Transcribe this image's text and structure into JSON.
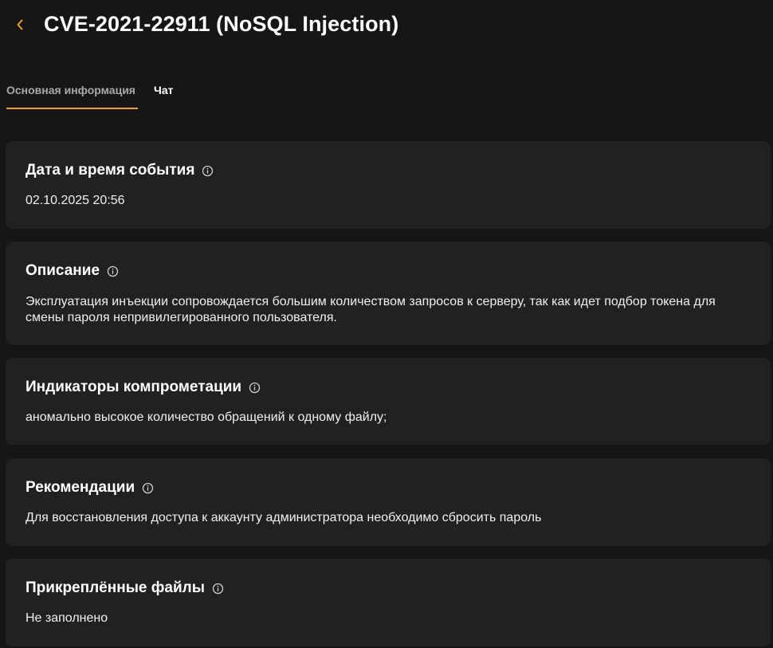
{
  "header": {
    "title": "CVE-2021-22911 (NoSQL Injection)",
    "back_icon": "chevron-left-icon",
    "accent_color": "#f0a020"
  },
  "tabs": [
    {
      "label": "Основная информация",
      "active": true
    },
    {
      "label": "Чат",
      "active": false
    }
  ],
  "sections": [
    {
      "title": "Дата и время события",
      "body": "02.10.2025 20:56",
      "icon": "info-icon"
    },
    {
      "title": "Описание",
      "body": "Эксплуатация инъекции сопровождается большим количеством запросов к серверу, так как идет подбор токена для смены пароля непривилегированного пользователя.",
      "icon": "info-icon"
    },
    {
      "title": "Индикаторы компрометации",
      "body": "аномально высокое количество обращений к одному файлу;",
      "icon": "info-icon"
    },
    {
      "title": "Рекомендации",
      "body": "Для восстановления доступа к аккаунту администратора необходимо сбросить пароль",
      "icon": "info-icon"
    },
    {
      "title": "Прикреплённые файлы",
      "body": "Не заполнено",
      "icon": "info-icon"
    }
  ]
}
